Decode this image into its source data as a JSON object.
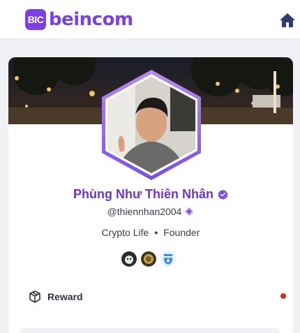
{
  "header": {
    "logo_badge": "BIC",
    "logo_text": "beincom",
    "brand_color": "#7b3fe4"
  },
  "profile": {
    "name": "Phùng Như Thiên Nhân",
    "handle": "@thiennhan2004",
    "role_left": "Crypto Life",
    "role_separator": "•",
    "role_right": "Founder",
    "name_color": "#6c36c8",
    "verified_icon": "verified-check-icon",
    "badges": [
      "dark-cat-badge",
      "gold-coin-badge",
      "blue-shield-badge"
    ]
  },
  "menu": {
    "reward_label": "Reward",
    "reward_icon": "box-icon",
    "notification_color": "#e0281f"
  }
}
